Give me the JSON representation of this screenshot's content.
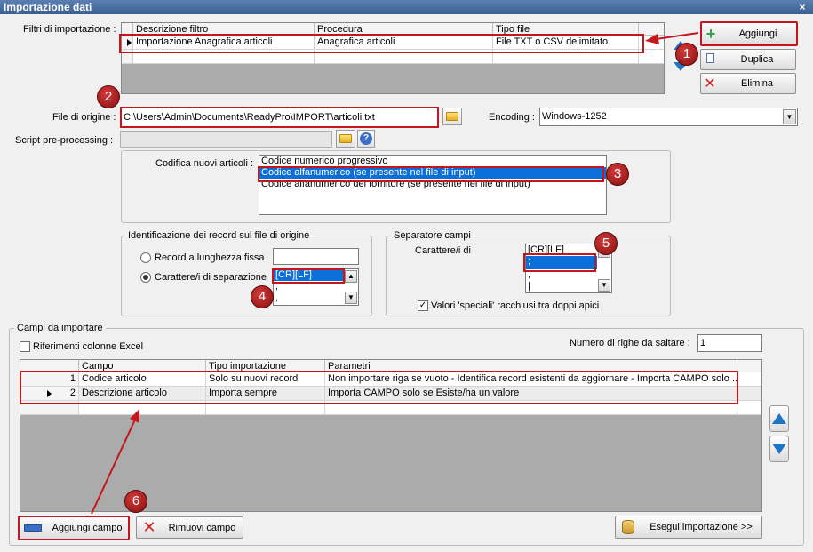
{
  "window": {
    "title": "Importazione dati",
    "close": "×"
  },
  "filters": {
    "label": "Filtri di importazione :",
    "columns": [
      "Descrizione filtro",
      "Procedura",
      "Tipo file"
    ],
    "rows": [
      [
        "Importazione Anagrafica articoli",
        "Anagrafica articoli",
        "File TXT o CSV delimitato"
      ]
    ],
    "buttons": {
      "add": "Aggiungi",
      "duplicate": "Duplica",
      "delete": "Elimina"
    }
  },
  "source": {
    "file_label": "File di origine :",
    "file_value": "C:\\Users\\Admin\\Documents\\ReadyPro\\IMPORT\\articoli.txt",
    "encoding_label": "Encoding :",
    "encoding_value": "Windows-1252",
    "script_label": "Script pre-processing :",
    "script_value": ""
  },
  "coding": {
    "label": "Codifica nuovi articoli :",
    "options": [
      "Codice numerico progressivo",
      "Codice alfanumerico (se presente nel file di input)",
      "Codice alfanumerico del fornitore (se presente nel file di input)"
    ],
    "selected": 1
  },
  "record_id": {
    "title": "Identificazione dei record sul file di origine",
    "fixed_label": "Record a lunghezza fissa",
    "sep_label": "Carattere/i di separazione",
    "sep_options": [
      "[CR][LF]",
      ";",
      ","
    ]
  },
  "field_sep": {
    "title": "Separatore campi",
    "label": "Carattere/i di",
    "options": [
      "[CR][LF]",
      ";",
      ",",
      "|"
    ],
    "quoted_label": "Valori 'speciali' racchiusi tra doppi apici"
  },
  "fields": {
    "title": "Campi da importare",
    "excel_label": "Riferimenti colonne Excel",
    "skip_label": "Numero di righe da saltare :",
    "skip_value": "1",
    "columns": [
      "Campo",
      "Tipo importazione",
      "Parametri"
    ],
    "rows": [
      {
        "n": "1",
        "campo": "Codice articolo",
        "tipo": "Solo su nuovi record",
        "param": "Non importare riga se vuoto - Identifica record esistenti da aggiornare - Importa CAMPO solo ..."
      },
      {
        "n": "2",
        "campo": "Descrizione articolo",
        "tipo": "Importa sempre",
        "param": "Importa CAMPO solo se Esiste/ha un valore"
      }
    ],
    "add_button": "Aggiungi campo",
    "remove_button": "Rimuovi campo",
    "run_button": "Esegui importazione >>"
  },
  "badges": [
    "1",
    "2",
    "3",
    "4",
    "5",
    "6"
  ],
  "colors": {
    "highlight_red": "#c4161c",
    "selection_blue": "#0a6fd8"
  }
}
